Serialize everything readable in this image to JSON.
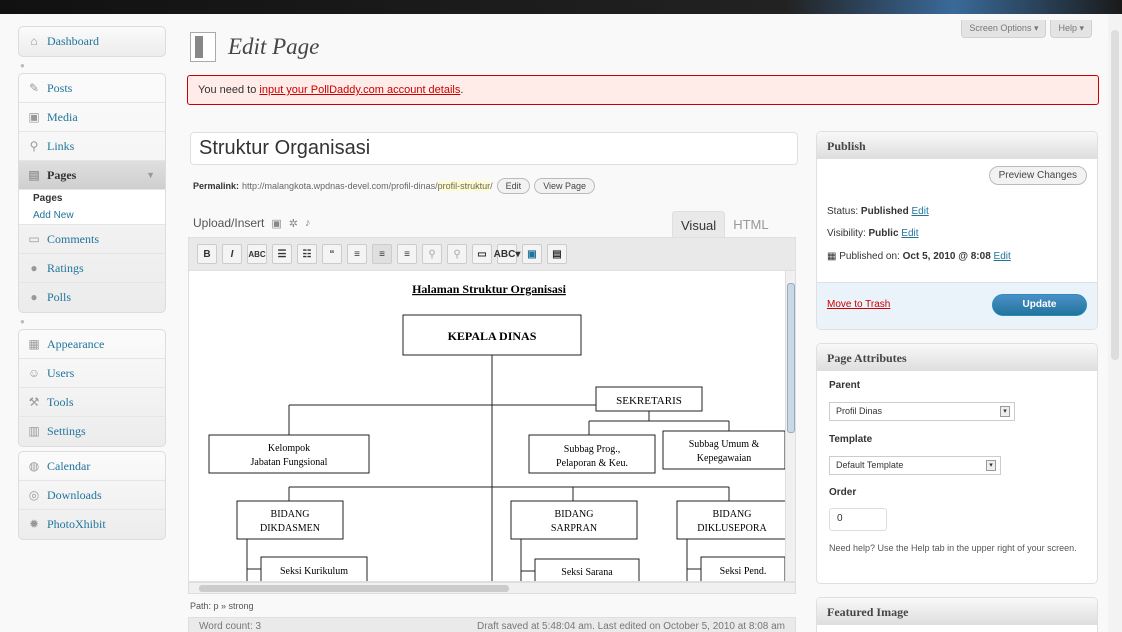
{
  "screen_options": {
    "screen_options": "Screen Options ▾",
    "help": "Help ▾"
  },
  "sidebar": {
    "groups": [
      [
        {
          "label": "Dashboard",
          "icon": "dashboard-icon"
        }
      ],
      [
        {
          "label": "Posts",
          "icon": "pushpin-icon"
        },
        {
          "label": "Media",
          "icon": "media-icon"
        },
        {
          "label": "Links",
          "icon": "link-icon"
        },
        {
          "label": "Pages",
          "icon": "pages-icon"
        }
      ]
    ],
    "submenu": {
      "current": "Pages",
      "add_new": "Add New"
    },
    "after_pages": [
      {
        "label": "Comments",
        "icon": "comment-icon"
      },
      {
        "label": "Ratings",
        "icon": "ratings-icon"
      },
      {
        "label": "Polls",
        "icon": "polls-icon"
      }
    ],
    "group3": [
      {
        "label": "Appearance",
        "icon": "appearance-icon"
      },
      {
        "label": "Users",
        "icon": "users-icon"
      },
      {
        "label": "Tools",
        "icon": "tools-icon"
      },
      {
        "label": "Settings",
        "icon": "settings-icon"
      }
    ],
    "group4": [
      {
        "label": "Calendar",
        "icon": "calendar-icon"
      },
      {
        "label": "Downloads",
        "icon": "downloads-icon"
      },
      {
        "label": "PhotoXhibit",
        "icon": "photo-icon"
      }
    ]
  },
  "header": {
    "title": "Edit Page"
  },
  "notice": {
    "prefix": "You need to ",
    "link": "input your PollDaddy.com account details",
    "suffix": "."
  },
  "post": {
    "title": "Struktur Organisasi",
    "permalink_label": "Permalink:",
    "permalink_base": "http://malangkota.wpdnas-devel.com/profil-dinas/",
    "permalink_slug": "profil-struktur",
    "edit": "Edit",
    "view_page": "View Page"
  },
  "editor": {
    "upload_label": "Upload/Insert",
    "tab_visual": "Visual",
    "tab_html": "HTML",
    "path": "Path: p » strong",
    "word_count": "Word count: 3",
    "draft_status": "Draft saved at 5:48:04 am. Last edited on October 5, 2010 at 8:08 am"
  },
  "org_chart": {
    "heading": "Halaman Struktur Organisasi",
    "head": "KEPALA DINAS",
    "secretary": "SEKRETARIS",
    "jabatan": [
      "Kelompok",
      "Jabatan Fungsional"
    ],
    "subbag1": [
      "Subbag Prog.,",
      "Pelaporan & Keu."
    ],
    "subbag2": [
      "Subbag Umum &",
      "Kepegawaian"
    ],
    "bidang1": [
      "BIDANG",
      "DIKDASMEN"
    ],
    "bidang2": [
      "BIDANG",
      "SARPRAN"
    ],
    "bidang3": [
      "BIDANG",
      "DIKLUSEPORA"
    ],
    "seksi1": "Seksi Kurikulum",
    "seksi2": "Seksi Sarana",
    "seksi3": "Seksi Pend."
  },
  "publish": {
    "title": "Publish",
    "preview": "Preview Changes",
    "status_label": "Status:",
    "status_value": "Published",
    "visibility_label": "Visibility:",
    "visibility_value": "Public",
    "published_label": "Published on:",
    "published_value": "Oct 5, 2010 @ 8:08",
    "edit": "Edit",
    "trash": "Move to Trash",
    "update": "Update"
  },
  "attributes": {
    "title": "Page Attributes",
    "parent_label": "Parent",
    "parent_value": "Profil Dinas",
    "template_label": "Template",
    "template_value": "Default Template",
    "order_label": "Order",
    "order_value": "0",
    "help": "Need help? Use the Help tab in the upper right of your screen."
  },
  "featured": {
    "title": "Featured Image"
  }
}
